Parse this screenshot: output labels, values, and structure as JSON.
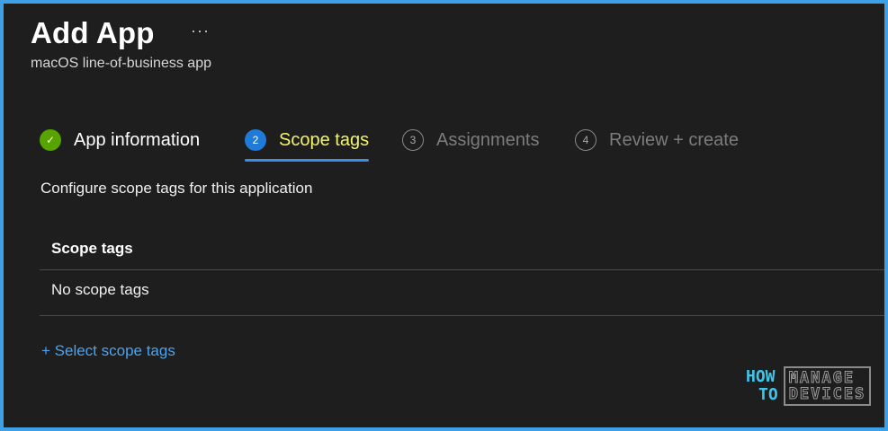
{
  "header": {
    "title": "Add App",
    "more": "···",
    "subtitle": "macOS line-of-business app"
  },
  "steps": [
    {
      "number": "✓",
      "label": "App information",
      "state": "done"
    },
    {
      "number": "2",
      "label": "Scope tags",
      "state": "active"
    },
    {
      "number": "3",
      "label": "Assignments",
      "state": "pending"
    },
    {
      "number": "4",
      "label": "Review + create",
      "state": "pending"
    }
  ],
  "main": {
    "description": "Configure scope tags for this application",
    "table": {
      "header": "Scope tags",
      "rows": [
        "No scope tags"
      ]
    },
    "select_link": "+ Select scope tags"
  },
  "watermark": {
    "line1_left": "HOW",
    "line2_left": "TO",
    "line1_right": "MANAGE",
    "line2_right": "DEVICES"
  },
  "colors": {
    "frame_border": "#3ea0e6",
    "active_step": "#f3f36b",
    "link": "#4aa3f0",
    "check": "#57a300"
  }
}
